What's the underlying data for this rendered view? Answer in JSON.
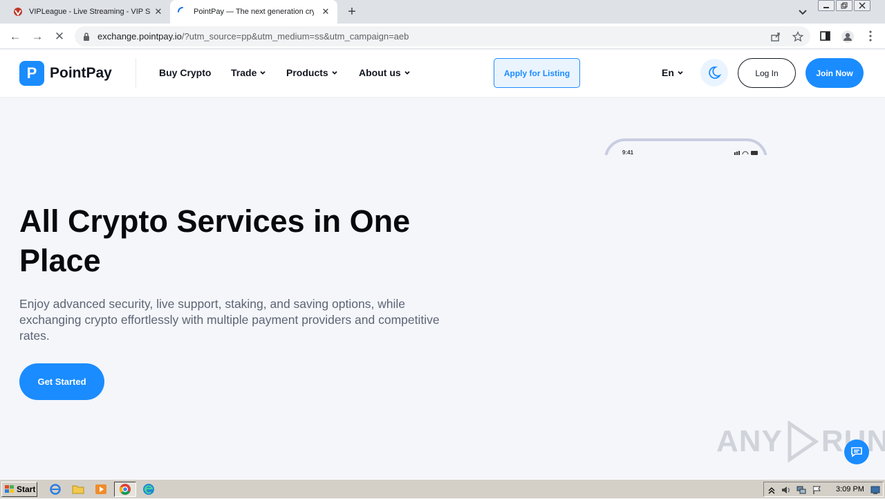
{
  "browser": {
    "tabs": [
      {
        "title": "VIPLeague - Live Streaming - VIP Sp",
        "icon": "vipleague-favicon",
        "active": false
      },
      {
        "title": "PointPay — The next generation cry",
        "icon": "loading-spinner-icon",
        "active": true
      }
    ],
    "url": "exchange.pointpay.io",
    "url_query": "/?utm_source=pp&utm_medium=ss&utm_campaign=aeb"
  },
  "site": {
    "brand": "PointPay",
    "logo_letter": "P",
    "nav": [
      {
        "label": "Buy Crypto",
        "has_dropdown": false
      },
      {
        "label": "Trade",
        "has_dropdown": true
      },
      {
        "label": "Products",
        "has_dropdown": true
      },
      {
        "label": "About us",
        "has_dropdown": true
      }
    ],
    "apply_listing": "Apply for Listing",
    "language": "En",
    "login": "Log In",
    "join": "Join Now"
  },
  "hero": {
    "title": "All Crypto Services in One Place",
    "subtitle": "Enjoy advanced security, live support, staking, and saving options, while exchanging crypto effortlessly with multiple payment providers and competitive rates.",
    "cta": "Get Started",
    "phone_time": "9:41"
  },
  "watermark": {
    "text_left": "ANY",
    "text_right": "RUN"
  },
  "taskbar": {
    "start": "Start",
    "clock": "3:09 PM"
  },
  "colors": {
    "brand": "#1a8cff",
    "page_bg": "#f4f6fa",
    "text_dark": "#07090d",
    "text_muted": "#5d6473"
  }
}
